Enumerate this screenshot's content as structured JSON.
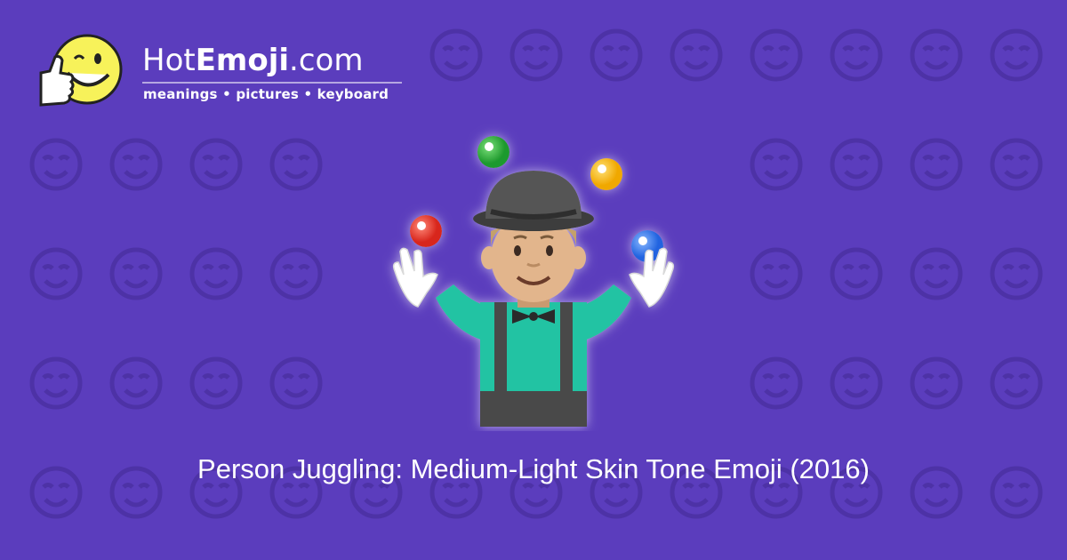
{
  "brand": {
    "part1": "Hot",
    "part2": "Emoji",
    "part3": ".com",
    "tagline": "meanings • pictures • keyboard"
  },
  "caption": "Person Juggling: Medium-Light Skin Tone Emoji (2016)",
  "colors": {
    "background": "#5b3dbd",
    "pattern": "#4d32a6",
    "shirt": "#22c7a6",
    "hat": "#4a4a4a",
    "skin": "#e2b58c"
  },
  "icons": {
    "logo": "thumbs-up-wink-face-icon",
    "main": "person-juggling-medium-light-skin-tone-emoji"
  }
}
